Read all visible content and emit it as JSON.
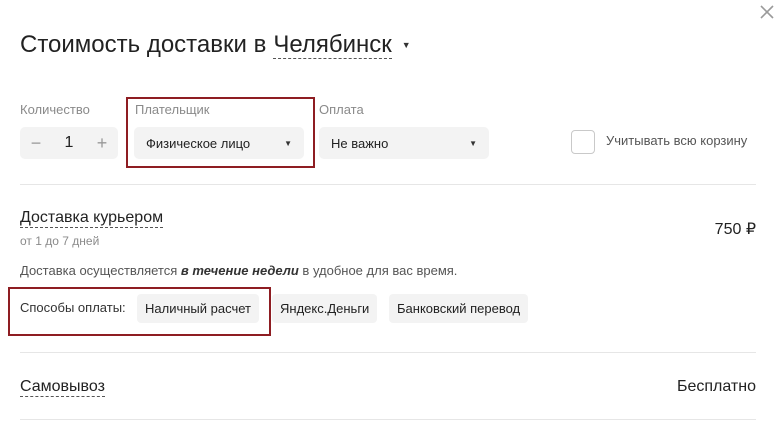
{
  "header": {
    "title_prefix": "Стоимость доставки в",
    "city": "Челябинск",
    "caret": "▼",
    "close": "×"
  },
  "filters": {
    "quantity": {
      "label": "Количество",
      "minus": "−",
      "value": "1",
      "plus": "+"
    },
    "payer": {
      "label": "Плательщик",
      "value": "Физическое лицо",
      "caret": "▼"
    },
    "payment": {
      "label": "Оплата",
      "value": "Не важно",
      "caret": "▼"
    },
    "whole_cart": {
      "label": "Учитывать всю корзину",
      "checked": false
    }
  },
  "methods": [
    {
      "title": "Доставка курьером",
      "period": "от 1 до 7 дней",
      "price": "750 ₽",
      "description_before": "Доставка осуществляется ",
      "description_bold": "в течение недели",
      "description_after": " в удобное для вас время.",
      "payment_label": "Способы оплаты:",
      "payment_options": [
        "Наличный расчет",
        "Яндекс.Деньги",
        "Банковский перевод"
      ]
    },
    {
      "title": "Самовывоз",
      "price": "Бесплатно"
    }
  ],
  "colors": {
    "highlight_border": "#8e1d22",
    "control_bg": "#f3f3f3",
    "divider": "#e6e6e6"
  }
}
